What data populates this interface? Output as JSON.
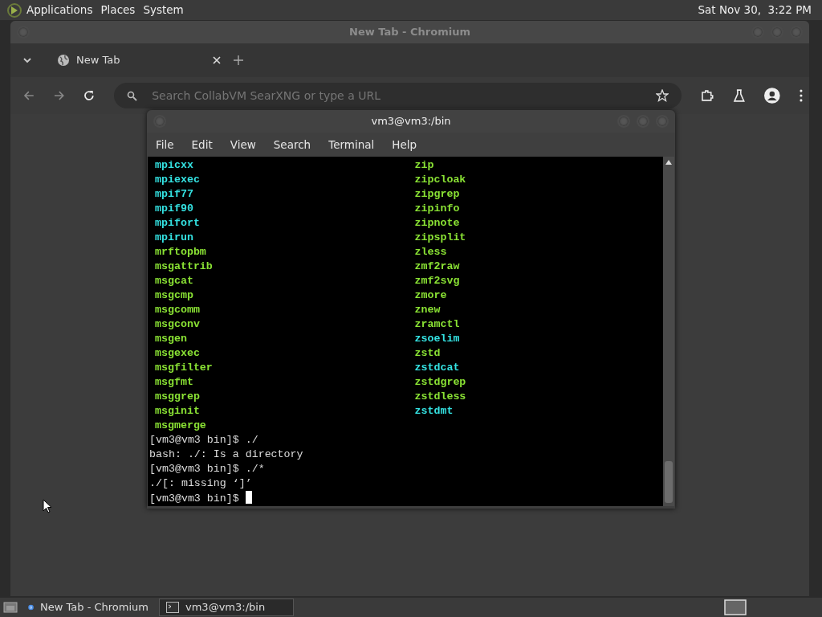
{
  "top_panel": {
    "menus": [
      "Applications",
      "Places",
      "System"
    ],
    "clock": "Sat Nov 30,  3:22 PM"
  },
  "browser": {
    "title": "New Tab - Chromium",
    "tabs": [
      {
        "label": "New Tab",
        "selected": true
      }
    ],
    "omnibox": {
      "placeholder": "Search CollabVM SearXNG or type a URL"
    }
  },
  "terminal": {
    "title": "vm3@vm3:/bin",
    "menu": [
      "File",
      "Edit",
      "View",
      "Search",
      "Terminal",
      "Help"
    ],
    "columns": [
      [
        {
          "name": "mpicxx",
          "kind": "link"
        },
        {
          "name": "mpiexec",
          "kind": "link"
        },
        {
          "name": "mpif77",
          "kind": "link"
        },
        {
          "name": "mpif90",
          "kind": "link"
        },
        {
          "name": "mpifort",
          "kind": "link"
        },
        {
          "name": "mpirun",
          "kind": "link"
        },
        {
          "name": "mrftopbm",
          "kind": "exec"
        },
        {
          "name": "msgattrib",
          "kind": "exec"
        },
        {
          "name": "msgcat",
          "kind": "exec"
        },
        {
          "name": "msgcmp",
          "kind": "exec"
        },
        {
          "name": "msgcomm",
          "kind": "exec"
        },
        {
          "name": "msgconv",
          "kind": "exec"
        },
        {
          "name": "msgen",
          "kind": "exec"
        },
        {
          "name": "msgexec",
          "kind": "exec"
        },
        {
          "name": "msgfilter",
          "kind": "exec"
        },
        {
          "name": "msgfmt",
          "kind": "exec"
        },
        {
          "name": "msggrep",
          "kind": "exec"
        },
        {
          "name": "msginit",
          "kind": "exec"
        },
        {
          "name": "msgmerge",
          "kind": "exec"
        }
      ],
      [
        {
          "name": "zip",
          "kind": "exec"
        },
        {
          "name": "zipcloak",
          "kind": "exec"
        },
        {
          "name": "zipgrep",
          "kind": "exec"
        },
        {
          "name": "zipinfo",
          "kind": "exec"
        },
        {
          "name": "zipnote",
          "kind": "exec"
        },
        {
          "name": "zipsplit",
          "kind": "exec"
        },
        {
          "name": "zless",
          "kind": "exec"
        },
        {
          "name": "zmf2raw",
          "kind": "exec"
        },
        {
          "name": "zmf2svg",
          "kind": "exec"
        },
        {
          "name": "zmore",
          "kind": "exec"
        },
        {
          "name": "znew",
          "kind": "exec"
        },
        {
          "name": "zramctl",
          "kind": "exec"
        },
        {
          "name": "zsoelim",
          "kind": "link"
        },
        {
          "name": "zstd",
          "kind": "exec"
        },
        {
          "name": "zstdcat",
          "kind": "link"
        },
        {
          "name": "zstdgrep",
          "kind": "exec"
        },
        {
          "name": "zstdless",
          "kind": "exec"
        },
        {
          "name": "zstdmt",
          "kind": "link"
        }
      ]
    ],
    "lines": [
      "[vm3@vm3 bin]$ ./",
      "bash: ./: Is a directory",
      "[vm3@vm3 bin]$ ./*",
      "./[: missing ‘]’",
      "[vm3@vm3 bin]$ "
    ]
  },
  "taskbar": {
    "tasks": [
      {
        "label": "New Tab - Chromium",
        "kind": "browser",
        "selected": false
      },
      {
        "label": "vm3@vm3:/bin",
        "kind": "terminal",
        "selected": true
      }
    ]
  }
}
